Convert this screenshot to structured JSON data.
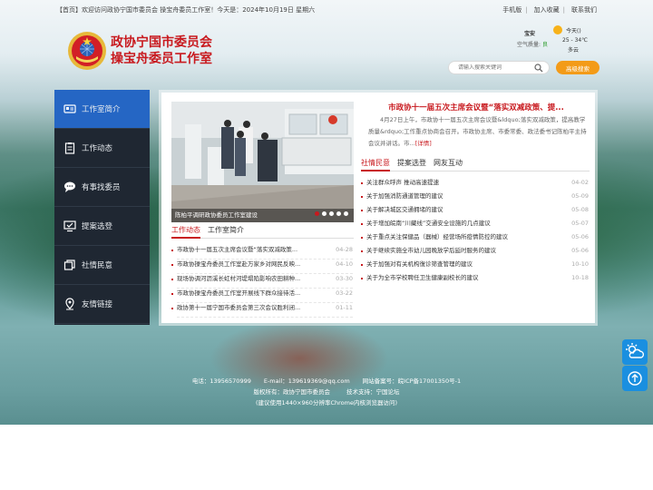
{
  "topbar": {
    "welcome": "【首页】欢迎访问政协宁国市委员会 操宝舟委员工作室！今天是：2024年10月19日 星期六",
    "links": [
      "手机版",
      "加入收藏",
      "联系我们"
    ]
  },
  "header": {
    "title_line1": "政协宁国市委员会",
    "title_line2": "操宝舟委员工作室"
  },
  "weather": {
    "city": "宝安",
    "air_quality_label": "空气质量:",
    "air_quality_value": "良",
    "today_label": "今天(",
    "today_suffix": ")",
    "temp": "25 - 34℃",
    "desc": "多云"
  },
  "search": {
    "placeholder": "请输入搜索关键词",
    "button": "高级搜索"
  },
  "sidebar": {
    "items": [
      {
        "label": "工作室简介",
        "icon": "id-card-icon",
        "active": true
      },
      {
        "label": "工作动态",
        "icon": "clipboard-icon",
        "active": false
      },
      {
        "label": "有事找委员",
        "icon": "chat-bubble-icon",
        "active": false
      },
      {
        "label": "提案选登",
        "icon": "monitor-check-icon",
        "active": false
      },
      {
        "label": "社情民意",
        "icon": "layers-icon",
        "active": false
      },
      {
        "label": "友情链接",
        "icon": "location-pin-icon",
        "active": false
      }
    ]
  },
  "slider": {
    "caption": "陈柏平调研政协委员工作室建设",
    "dots": 5,
    "active_dot": 1
  },
  "headline": {
    "title": "市政协十一届五次主席会议暨“落实双减政策、提...",
    "excerpt": "4月27日上午，市政协十一届五次主席会议暨&ldquo;落实双减政策，提高教学质量&rdquo;工作重点协商会召开。市政协主席、市委常委、政法委书记陈柏平主持会议并讲话。市...",
    "more": "[详情]"
  },
  "left_tabs": [
    "工作动态",
    "工作室简介"
  ],
  "left_news": [
    {
      "title": "市政协十一届五次主席会议暨“落实双减政策...",
      "date": "04-28"
    },
    {
      "title": "市政协操宝舟委员工作室赴万家乡对网民反映...",
      "date": "04-10"
    },
    {
      "title": "现场协调河沥溪长虹村河堤塌陷影响农田耕种...",
      "date": "03-30"
    },
    {
      "title": "市政协操宝舟委员工作室开展线下群众接待活...",
      "date": "03-22"
    },
    {
      "title": "政协第十一届宁国市委员会第三次会议胜利闭...",
      "date": "01-11"
    }
  ],
  "right_tabs": [
    "社情民意",
    "提案选登",
    "网友互动"
  ],
  "right_news": [
    {
      "title": "关注群众呼声 推动高速提速",
      "date": "04-02"
    },
    {
      "title": "关于加强消防通道管理的建议",
      "date": "05-09"
    },
    {
      "title": "关于解决城区交通拥堵的建议",
      "date": "05-08"
    },
    {
      "title": "关于增加皖南“川藏线”交通安全设施的几点建议",
      "date": "05-07"
    },
    {
      "title": "关于重点关注保健品（器械）经营场所疫情防控的建议",
      "date": "05-06"
    },
    {
      "title": "关于继续实施全市幼儿园晚放学后延时服务的建议",
      "date": "05-06"
    },
    {
      "title": "关于加强对有关机构復诊筛查管理的建议",
      "date": "10-10"
    },
    {
      "title": "关于为全市学校聘任卫生健康副校长的建议",
      "date": "10-18"
    }
  ],
  "footer": {
    "phone": "电话：13956570999",
    "email": "E-mail：139619369@qq.com",
    "icp": "网站备案号：皖ICP备17001350号-1",
    "copyright": "版权所有：政协宁国市委员会",
    "support": "技术支持：宁国论坛",
    "note": "(建议使用1440×960分辨率Chrome内核浏览器访问)"
  },
  "colors": {
    "brand_red": "#c8191e",
    "sidebar_bg": "#1f2732",
    "sidebar_active": "#2566c4",
    "search_button": "#f39b18",
    "float_button": "#1a8fe0"
  }
}
